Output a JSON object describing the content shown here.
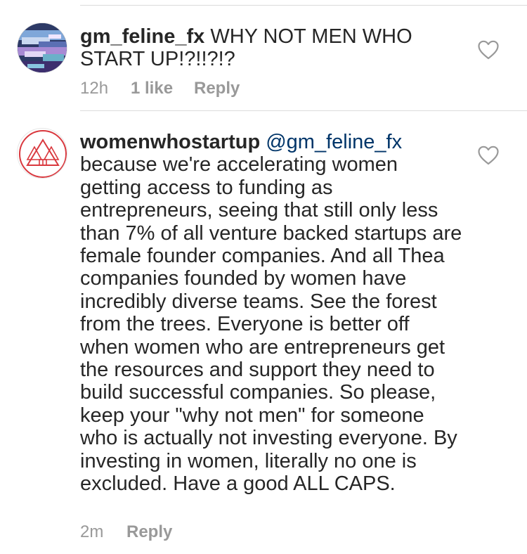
{
  "comments": [
    {
      "username": "gm_feline_fx",
      "mention": "",
      "text": " WHY NOT MEN WHO START UP!?!!?!?",
      "time": "12h",
      "likes": "1 like",
      "reply_label": "Reply",
      "avatar_icon": "glitch-art-avatar",
      "heart_icon": "heart-outline-icon"
    },
    {
      "username": "womenwhostartup",
      "mention": "@gm_feline_fx",
      "text": "because we're accelerating women getting access to funding as entrepreneurs, seeing that still only less than 7% of all venture backed startups are female founder companies. And all Thea companies founded by women have incredibly diverse teams. See the forest from the trees. Everyone is better off when women who are entrepreneurs get the resources and support they need to build successful companies. So please, keep your \"why not men\" for someone who is actually not investing everyone. By investing in women, literally no one is excluded. Have a good ALL CAPS.",
      "time": "2m",
      "reply_label": "Reply",
      "avatar_icon": "red-triangle-logo-avatar",
      "heart_icon": "heart-outline-icon"
    }
  ],
  "colors": {
    "text": "#262626",
    "meta": "#999999",
    "mention": "#003569",
    "divider": "#dbdbdb",
    "brand_red": "#d9383e"
  }
}
